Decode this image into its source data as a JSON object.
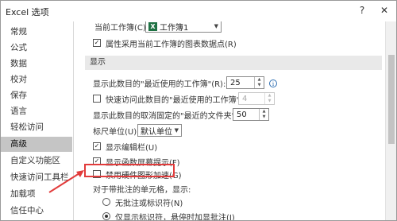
{
  "window": {
    "title": "Excel 选项"
  },
  "sidebar": {
    "items": [
      {
        "label": "常规"
      },
      {
        "label": "公式"
      },
      {
        "label": "数据"
      },
      {
        "label": "校对"
      },
      {
        "label": "保存"
      },
      {
        "label": "语言"
      },
      {
        "label": "轻松访问"
      },
      {
        "label": "高级",
        "selected": true
      },
      {
        "label": "自定义功能区"
      },
      {
        "label": "快速访问工具栏"
      },
      {
        "label": "加载项"
      },
      {
        "label": "信任中心"
      }
    ]
  },
  "workbook_section": {
    "current_workbook_label": "当前工作簿(C):",
    "current_workbook_value": "工作簿1",
    "attribute_follow_label": "属性采用当前工作簿的图表数据点(R)",
    "attribute_follow_checked": true
  },
  "display_section": {
    "header": "显示",
    "recent_workbooks_label": "显示此数目的\"最近使用的工作簿\"(R):",
    "recent_workbooks_value": "25",
    "quick_access_label": "快速访问此数目的\"最近使用的工作簿\"(Q):",
    "quick_access_value": "4",
    "quick_access_checked": false,
    "recent_folders_label": "显示此数目的取消固定的\"最近的文件夹\"(F):",
    "recent_folders_value": "50",
    "ruler_units_label": "标尺单位(U)",
    "ruler_units_value": "默认单位",
    "show_formula_bar_label": "显示编辑栏(U)",
    "show_formula_bar_checked": true,
    "show_function_tips_label": "显示函数屏幕提示(F)",
    "show_function_tips_checked": true,
    "disable_hw_accel_label": "禁用硬件图形加速(G)",
    "disable_hw_accel_checked": false,
    "comments_label": "对于带批注的单元格，显示:",
    "no_comments_label": "无批注或标识符(N)",
    "indicator_only_label": "仅显示标识符，悬停时加显批注(I)",
    "selected_comment_option": "indicator_only"
  },
  "colors": {
    "highlight": "#e23b3b",
    "excel_green": "#1f7244",
    "selected_sidebar": "#c5c5c5"
  },
  "icons": [
    "help-icon",
    "close-icon",
    "info-icon",
    "excel-icon",
    "dropdown-arrow-icon",
    "red-arrow-annotation"
  ]
}
